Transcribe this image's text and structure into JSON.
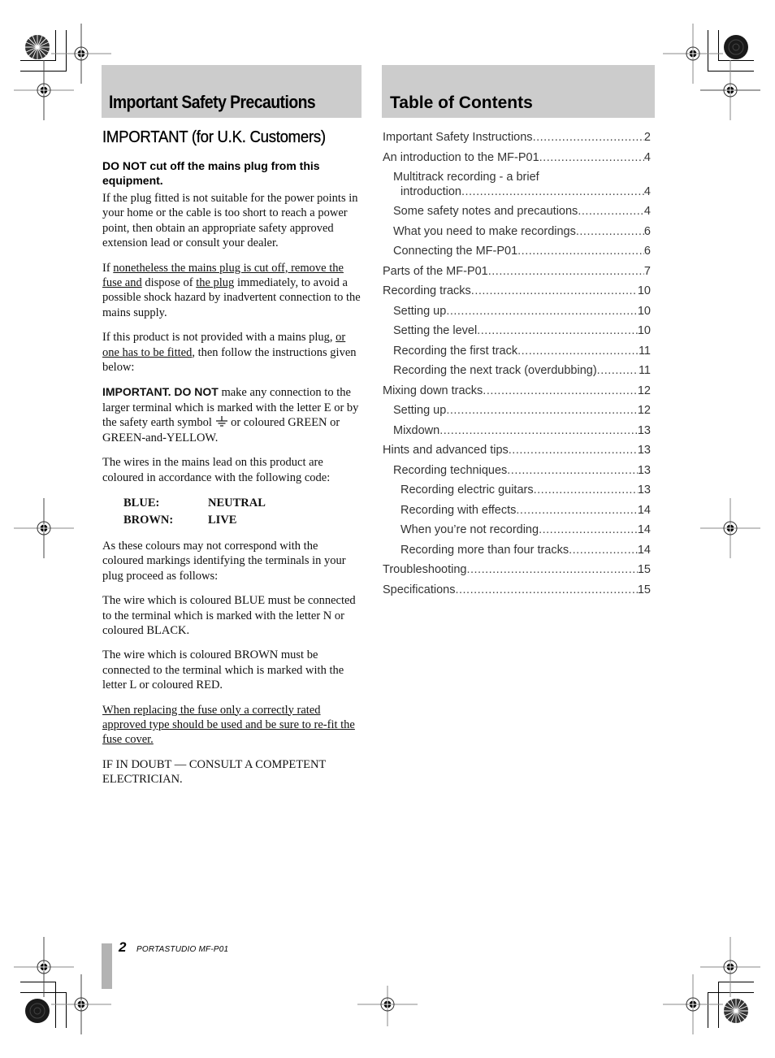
{
  "left_section": {
    "header_title": "Important Safety Precautions",
    "uk_heading": "IMPORTANT (for U.K. Customers)",
    "subheading": "DO NOT cut off the mains plug from this equipment.",
    "p1": "If the plug fitted is not suitable for the power points in your home or the cable is too short to reach a power point, then obtain an appropriate safety approved extension lead or consult your dealer.",
    "p2": {
      "s1": "If ",
      "u1": "nonetheless the mains plug is cut off, remove the fuse and",
      "s2": " dispose of ",
      "u2": "the plug",
      "s3": " immediately, to avoid a possible shock hazard by inadvertent connection to the mains supply."
    },
    "p3": {
      "s1": "If this product is not provided with a mains plug, ",
      "u1": "or one has to be fitted",
      "s2": ", then follow the instructions given below:"
    },
    "p4": {
      "bold": "IMPORTANT. DO NOT",
      "s1": " make any connection to the larger terminal which is marked with the letter E or by the safety earth symbol ",
      "icon": "earth-ground-symbol",
      "s2": " or coloured GREEN or GREEN-and-YELLOW."
    },
    "p5": "The wires in the mains lead on this product are coloured in accordance with the following code:",
    "wire_code": [
      {
        "colour": "BLUE:",
        "meaning": "NEUTRAL"
      },
      {
        "colour": "BROWN:",
        "meaning": "LIVE"
      }
    ],
    "p6": "As these colours may not correspond with the coloured markings identifying the terminals in your plug proceed as follows:",
    "p7": "The wire which is coloured BLUE must be connected to the terminal which is marked with the letter N or coloured BLACK.",
    "p8": "The wire which is coloured BROWN must be connected to the terminal which is marked with the letter L or coloured RED.",
    "p9": "When replacing the fuse only a correctly rated approved type should be used and be sure to re-fit the fuse cover.",
    "p10": "IF IN DOUBT — CONSULT A COMPETENT ELECTRICIAN."
  },
  "toc": {
    "header_title": "Table of Contents",
    "entries": [
      {
        "title": "Important Safety Instructions",
        "page": "2",
        "level": 1
      },
      {
        "title": "An introduction to the MF-P01",
        "page": "4",
        "level": 1
      },
      {
        "title": "Multitrack recording - a brief",
        "title_line2": "introduction",
        "page": "4",
        "level": 2
      },
      {
        "title": "Some safety notes and precautions",
        "page": "4",
        "level": 2
      },
      {
        "title": "What you need to make recordings",
        "page": "6",
        "level": 2
      },
      {
        "title": "Connecting the MF-P01",
        "page": "6",
        "level": 2
      },
      {
        "title": "Parts of the MF-P01",
        "page": "7",
        "level": 1
      },
      {
        "title": "Recording tracks",
        "page": "10",
        "level": 1
      },
      {
        "title": "Setting up",
        "page": "10",
        "level": 2
      },
      {
        "title": "Setting the level",
        "page": "10",
        "level": 2
      },
      {
        "title": "Recording the first track",
        "page": "11",
        "level": 2
      },
      {
        "title": "Recording the next track (overdubbing)",
        "page": "11",
        "level": 2
      },
      {
        "title": "Mixing down tracks",
        "page": "12",
        "level": 1
      },
      {
        "title": "Setting up",
        "page": "12",
        "level": 2
      },
      {
        "title": "Mixdown",
        "page": "13",
        "level": 2
      },
      {
        "title": "Hints and advanced tips",
        "page": "13",
        "level": 1
      },
      {
        "title": "Recording techniques",
        "page": "13",
        "level": 2
      },
      {
        "title": "Recording electric guitars",
        "page": "13",
        "level": 3
      },
      {
        "title": "Recording with effects",
        "page": "14",
        "level": 3
      },
      {
        "title": "When you’re not recording",
        "page": "14",
        "level": 3
      },
      {
        "title": "Recording more than four tracks",
        "page": "14",
        "level": 3
      },
      {
        "title": "Troubleshooting",
        "page": "15",
        "level": 1
      },
      {
        "title": "Specifications",
        "page": "15",
        "level": 1
      }
    ]
  },
  "footer": {
    "page_number": "2",
    "product": "PORTASTUDIO  MF-P01"
  },
  "colors": {
    "header_box": "#cccccc",
    "footer_bar": "#b3b3b3"
  }
}
